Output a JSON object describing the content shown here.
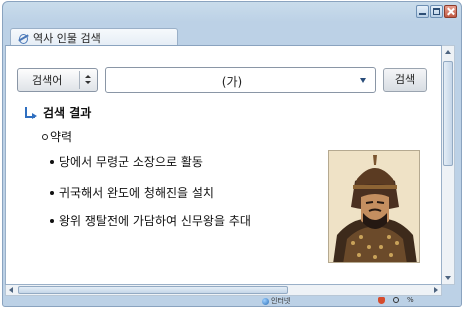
{
  "window": {
    "tab_title": "역사 인물 검색",
    "accent_color": "#2f6fc0"
  },
  "search": {
    "type_label": "검색어",
    "query_value": "(가)",
    "button_label": "검색"
  },
  "results": {
    "title": "검색 결과",
    "section_label": "약력",
    "items": [
      "당에서 무령군 소장으로 활동",
      "귀국해서 완도에 청해진을 설치",
      "왕위 쟁탈전에 가담하여 신무왕을 추대"
    ]
  },
  "statusbar": {
    "zone_label": "인터넷",
    "zoom_label": "%"
  }
}
